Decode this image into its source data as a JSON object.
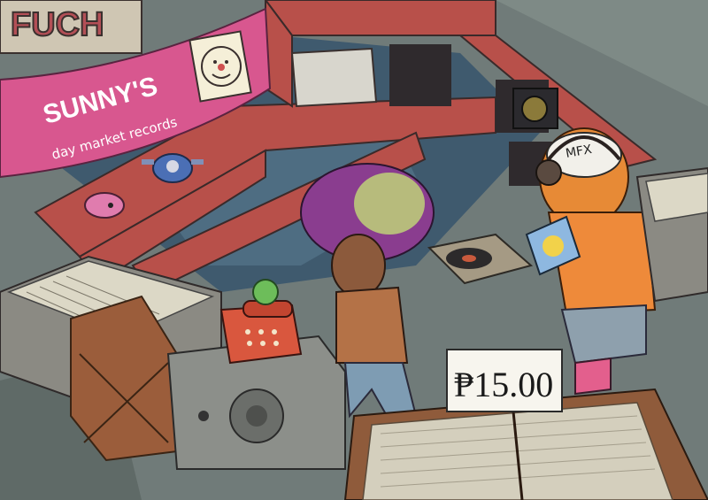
{
  "banner": {
    "brand": "SUNNY'S",
    "tagline": "day market records"
  },
  "top_sign": {
    "text": "FUCH"
  },
  "cap": {
    "text": "MFX"
  },
  "price_tag": {
    "text": "₱15.00"
  },
  "colors": {
    "booth_red": "#b8504a",
    "banner_pink": "#d8578f",
    "floor": "#6f7a78",
    "wood": "#8f5b3b",
    "crate_cream": "#ddd9c6"
  },
  "icons": [
    "sun-face-logo",
    "telephone",
    "turntable",
    "headphones",
    "vinyl-record",
    "robot-drone",
    "pink-creature",
    "green-frog-toy"
  ]
}
